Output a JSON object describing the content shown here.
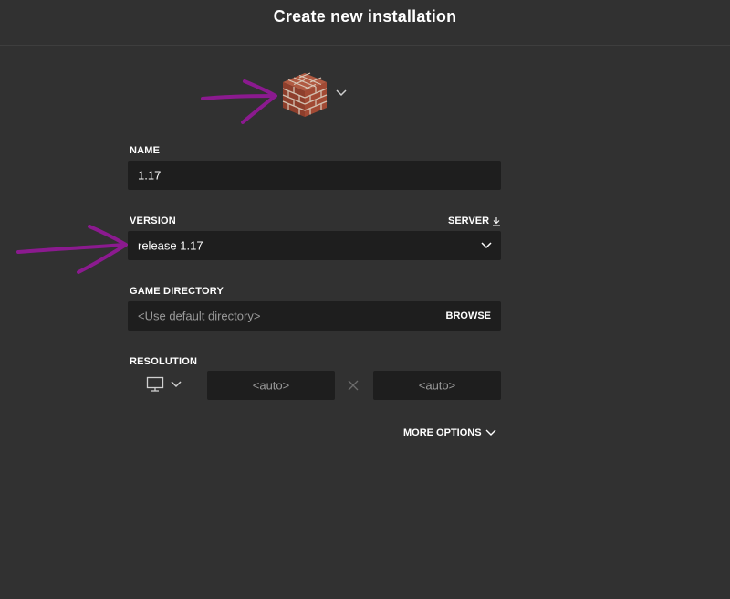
{
  "header": {
    "title": "Create new installation"
  },
  "icon_picker": {
    "icon": "brick-block-icon"
  },
  "name": {
    "label": "NAME",
    "value": "1.17"
  },
  "version": {
    "label": "VERSION",
    "server_label": "SERVER",
    "selected": "release 1.17"
  },
  "game_directory": {
    "label": "GAME DIRECTORY",
    "placeholder": "<Use default directory>",
    "browse_label": "BROWSE"
  },
  "resolution": {
    "label": "RESOLUTION",
    "width_placeholder": "<auto>",
    "height_placeholder": "<auto>"
  },
  "more_options": {
    "label": "MORE OPTIONS"
  },
  "colors": {
    "background": "#313131",
    "field_background": "#1e1e1e",
    "annotation_arrow": "#8b1a8f"
  }
}
